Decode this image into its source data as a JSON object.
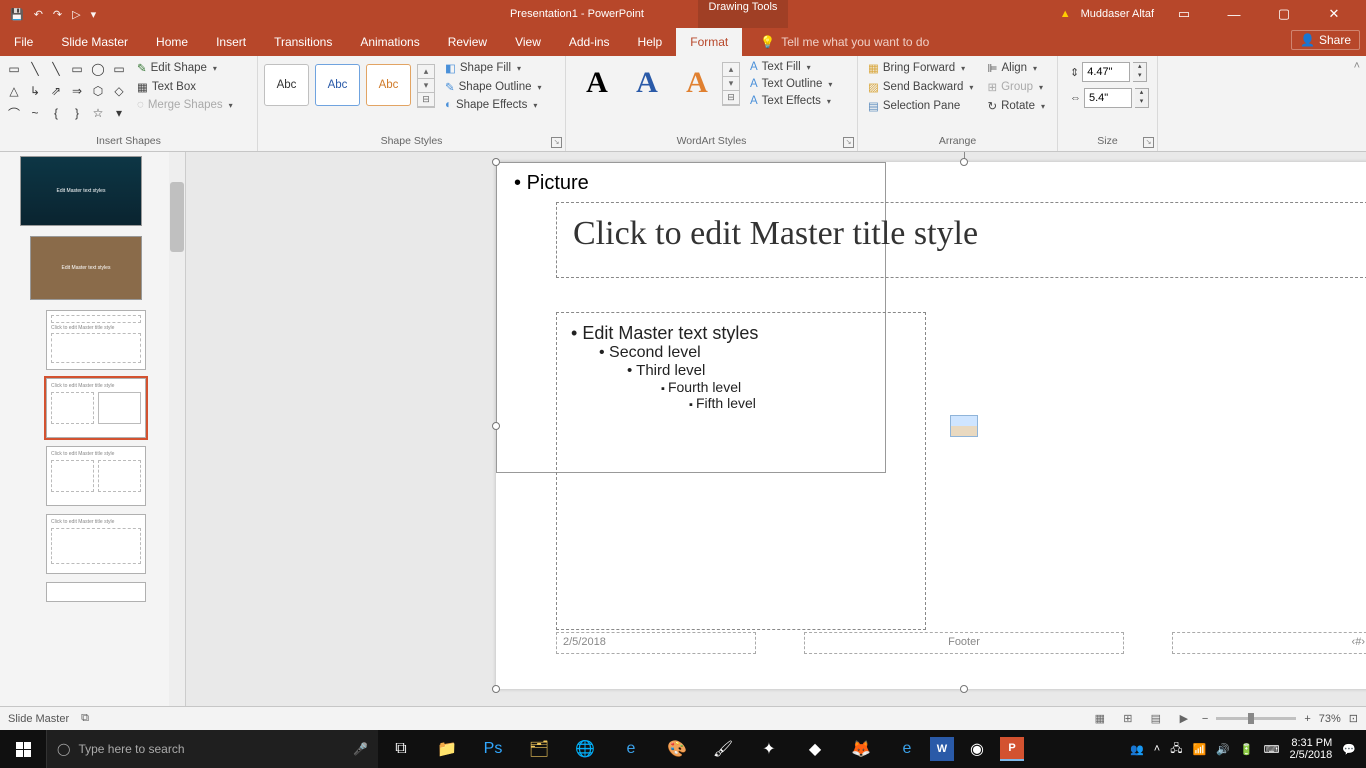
{
  "qat": {
    "save": "💾",
    "undo": "↶",
    "redo": "↷",
    "start": "▷"
  },
  "title": "Presentation1 - PowerPoint",
  "context_tab": "Drawing Tools",
  "user": "Muddaser Altaf",
  "menu": [
    "File",
    "Slide Master",
    "Home",
    "Insert",
    "Transitions",
    "Animations",
    "Review",
    "View",
    "Add-ins",
    "Help",
    "Format"
  ],
  "active_menu": "Format",
  "tellme": "Tell me what you want to do",
  "share": "Share",
  "ribbon": {
    "insert_shapes": {
      "edit_shape": "Edit Shape",
      "text_box": "Text Box",
      "merge": "Merge Shapes",
      "label": "Insert Shapes"
    },
    "shape_styles": {
      "fill": "Shape Fill",
      "outline": "Shape Outline",
      "effects": "Shape Effects",
      "label": "Shape Styles",
      "thumb": "Abc"
    },
    "wordart": {
      "text_fill": "Text Fill",
      "text_outline": "Text Outline",
      "text_effects": "Text Effects",
      "label": "WordArt Styles"
    },
    "arrange": {
      "bring_forward": "Bring Forward",
      "send_backward": "Send Backward",
      "selection_pane": "Selection Pane",
      "align": "Align",
      "group": "Group",
      "rotate": "Rotate",
      "label": "Arrange"
    },
    "size": {
      "height": "4.47\"",
      "width": "5.4\"",
      "label": "Size"
    }
  },
  "slide": {
    "title": "Click to edit Master title style",
    "bullets": {
      "l1": "Edit Master text styles",
      "l2": "Second level",
      "l3": "Third level",
      "l4": "Fourth level",
      "l5": "Fifth level"
    },
    "picture_label": "Picture",
    "date": "2/5/2018",
    "footer": "Footer",
    "num": "‹#›"
  },
  "thumbs": {
    "master_txt": "Edit Master text styles",
    "layout_title": "Click to edit Master title style"
  },
  "status": {
    "mode": "Slide Master",
    "zoom": "73%"
  },
  "taskbar": {
    "search_placeholder": "Type here to search",
    "time": "8:31 PM",
    "date": "2/5/2018"
  }
}
